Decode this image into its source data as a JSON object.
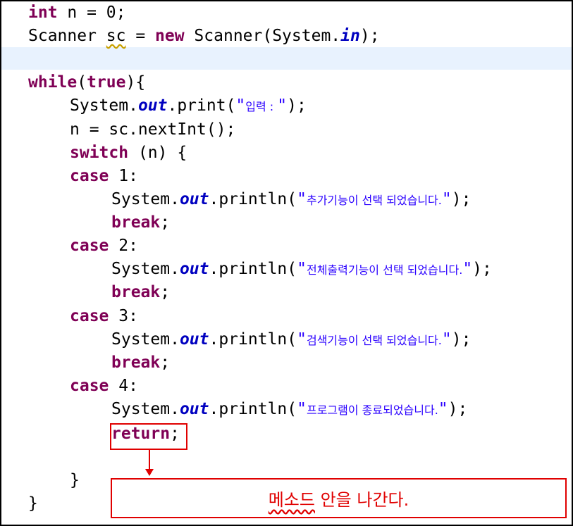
{
  "code": {
    "line1": {
      "kw": "int",
      "rest": " n = 0;"
    },
    "line2": {
      "a": "Scanner ",
      "b": "sc",
      "c": " = ",
      "kw": "new",
      "d": " Scanner(System.",
      "fld": "in",
      "e": ");"
    },
    "line4": {
      "kw": "while",
      "a": "(",
      "kw2": "true",
      "b": "){"
    },
    "line5": {
      "a": "System.",
      "fld": "out",
      "b": ".print(",
      "s1": "\"",
      "kor": "입력 : ",
      "s2": "\"",
      "c": ");"
    },
    "line6": {
      "a": "n = sc.nextInt();"
    },
    "line7": {
      "kw": "switch",
      "a": " (n) {"
    },
    "case1": {
      "kw": "case",
      "a": " 1:"
    },
    "print1": {
      "a": "System.",
      "fld": "out",
      "b": ".println(",
      "s1": "\"",
      "kor": "추가기능이 선택 되었습니다.",
      "s2": "\"",
      "c": ");"
    },
    "break1": {
      "kw": "break",
      "a": ";"
    },
    "case2": {
      "kw": "case",
      "a": " 2:"
    },
    "print2": {
      "a": "System.",
      "fld": "out",
      "b": ".println(",
      "s1": "\"",
      "kor": "전체출력기능이 선택 되었습니다.",
      "s2": "\"",
      "c": ");"
    },
    "break2": {
      "kw": "break",
      "a": ";"
    },
    "case3": {
      "kw": "case",
      "a": " 3:"
    },
    "print3": {
      "a": "System.",
      "fld": "out",
      "b": ".println(",
      "s1": "\"",
      "kor": "검색기능이 선택 되었습니다.",
      "s2": "\"",
      "c": ");"
    },
    "break3": {
      "kw": "break",
      "a": ";"
    },
    "case4": {
      "kw": "case",
      "a": " 4:"
    },
    "print4": {
      "a": "System.",
      "fld": "out",
      "b": ".println(",
      "s1": "\"",
      "kor": "프로그램이 종료되었습니다.",
      "s2": "\"",
      "c": ");"
    },
    "ret": {
      "kw": "return",
      "a": ";"
    },
    "close_switch": "}",
    "close_while": "}"
  },
  "callout": {
    "word1": "메소드",
    "rest": " 안을 나간다."
  },
  "colors": {
    "keyword": "#7f0055",
    "field": "#0000c0",
    "string": "#2a00ff",
    "annotation": "#e00000",
    "current_line": "#e8f2fe"
  }
}
